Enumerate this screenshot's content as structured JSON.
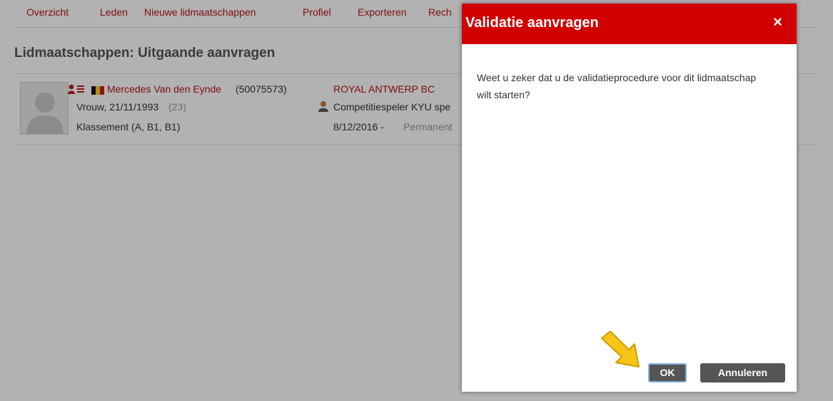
{
  "nav": {
    "items": [
      "Overzicht",
      "Leden",
      "Nieuwe lidmaatschappen",
      "Profiel",
      "Exporteren",
      "Rech"
    ]
  },
  "page": {
    "title": "Lidmaatschappen: Uitgaande aanvragen"
  },
  "member": {
    "name": "Mercedes Van den Eynde",
    "id": "(50075573)",
    "gender_dob": "Vrouw, 21/11/1993",
    "age": "(23)",
    "ranking": "Klassement (A, B1, B1)",
    "club": "ROYAL ANTWERP BC",
    "role": "Competitiespeler KYU spe",
    "date": "8/12/2016 - ",
    "duration": "Permanent"
  },
  "dialog": {
    "title": "Validatie aanvragen",
    "close": "×",
    "message": "Weet u zeker dat u de validatieprocedure voor dit lidmaatschap wilt starten?",
    "ok": "OK",
    "cancel": "Annuleren"
  },
  "colors": {
    "accent": "#b5161b",
    "dialog_header": "#d10000",
    "button": "#555555",
    "arrow": "#f5c518"
  },
  "icons": [
    "member-type-icon",
    "belgium-flag-icon",
    "player-role-icon",
    "close-icon",
    "pointer-arrow-icon"
  ]
}
